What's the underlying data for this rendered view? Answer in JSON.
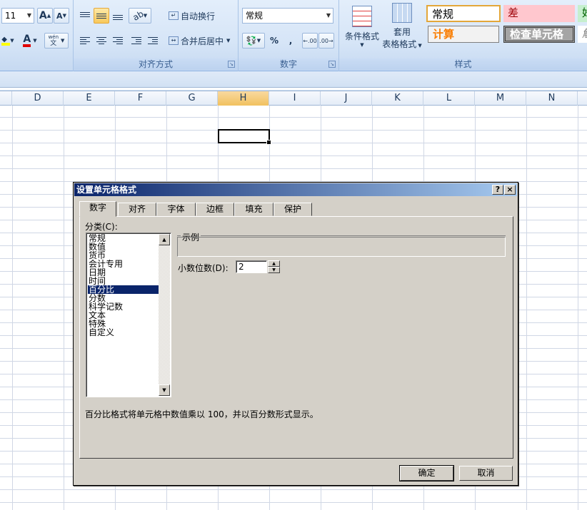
{
  "ribbon": {
    "font_size": "11",
    "grow_font": "A",
    "shrink_font": "A",
    "font_color_label": "A",
    "phonetic_label": "wén",
    "wrap_text": "自动换行",
    "merge_center": "合并后居中",
    "alignment_group": "对齐方式",
    "number_format": "常规",
    "percent": "%",
    "comma": ",",
    "inc_decimal": ".00",
    "dec_decimal": ".00",
    "number_group": "数字",
    "conditional_format": "条件格式",
    "table_format_1": "套用",
    "table_format_2": "表格格式",
    "styles_group": "样式",
    "styles": [
      {
        "label": "常规",
        "color": "#000000",
        "bg": "#ffffff",
        "border": "#e3a73a"
      },
      {
        "label": "差",
        "color": "#9c0006",
        "bg": "#ffc7ce",
        "border": "#ffc7ce"
      },
      {
        "label": "好",
        "color": "#006100",
        "bg": "#c6efce",
        "border": "#c6efce"
      },
      {
        "label": "计算",
        "color": "#fa7d00",
        "bg": "#f2f2f2",
        "border": "#7f7f7f"
      },
      {
        "label": "检查单元格",
        "color": "#ffffff",
        "bg": "#a5a5a5",
        "border": "#3f3f3f"
      },
      {
        "label": "解",
        "color": "#7f7f7f",
        "bg": "#ffffff",
        "border": "#ffffff"
      }
    ]
  },
  "sheet": {
    "columns": [
      "D",
      "E",
      "F",
      "G",
      "H",
      "I",
      "J",
      "K",
      "L",
      "M",
      "N"
    ],
    "selected_column": "H"
  },
  "dialog": {
    "title": "设置单元格格式",
    "help": "?",
    "close": "×",
    "tabs": [
      "数字",
      "对齐",
      "字体",
      "边框",
      "填充",
      "保护"
    ],
    "active_tab": "数字",
    "category_label": "分类(C):",
    "categories": [
      "常规",
      "数值",
      "货币",
      "会计专用",
      "日期",
      "时间",
      "百分比",
      "分数",
      "科学记数",
      "文本",
      "特殊",
      "自定义"
    ],
    "selected_category": "百分比",
    "sample_label": "示例",
    "decimal_label": "小数位数(D):",
    "decimal_value": "2",
    "description": "百分比格式将单元格中数值乘以 100，并以百分数形式显示。",
    "ok": "确定",
    "cancel": "取消"
  }
}
